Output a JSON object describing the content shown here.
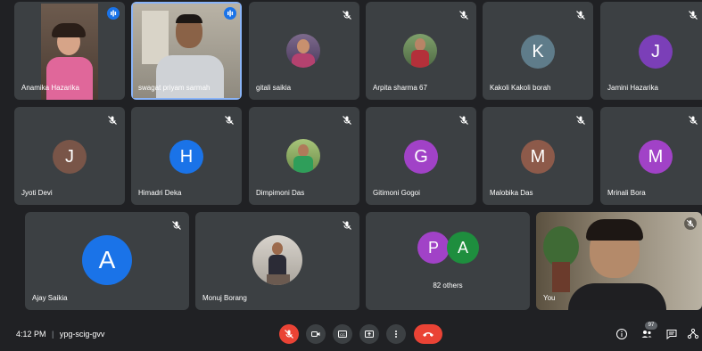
{
  "participants": [
    {
      "name": "Anamika Hazarika",
      "type": "photo",
      "speaking": true
    },
    {
      "name": "swagat priyam sarmah",
      "type": "photo",
      "speaking": true,
      "highlighted": true
    },
    {
      "name": "gitali saikia",
      "type": "photo",
      "muted": true
    },
    {
      "name": "Arpita sharma 67",
      "type": "photo",
      "muted": true
    },
    {
      "name": "Kakoli Kakoli borah",
      "initial": "K",
      "color": "#5f7c8a",
      "muted": true
    },
    {
      "name": "Jamini Hazarika",
      "initial": "J",
      "color": "#7b3fb8",
      "muted": true
    },
    {
      "name": "Jyoti Devi",
      "initial": "J",
      "color": "#795548",
      "muted": true
    },
    {
      "name": "Himadri Deka",
      "initial": "H",
      "color": "#1a73e8",
      "muted": true
    },
    {
      "name": "Dimpimoni Das",
      "type": "photo",
      "muted": true
    },
    {
      "name": "Gitimoni Gogoi",
      "initial": "G",
      "color": "#a142c7",
      "muted": true
    },
    {
      "name": "Malobika Das",
      "initial": "M",
      "color": "#8d5a4a",
      "muted": true
    },
    {
      "name": "Mrinali Bora",
      "initial": "M",
      "color": "#a142c7",
      "muted": true
    },
    {
      "name": "Ajay Saikia",
      "initial": "A",
      "color": "#1a73e8",
      "muted": true
    },
    {
      "name": "Monuj Borang",
      "type": "photo",
      "muted": true
    },
    {
      "name": "82 others",
      "others_initials": [
        "P",
        "A"
      ],
      "others_colors": [
        "#a142c7",
        "#1e8e3e"
      ]
    },
    {
      "name": "You",
      "type": "self-video",
      "muted": true
    }
  ],
  "bottom_bar": {
    "time": "4:12 PM",
    "separator": "|",
    "meeting_code": "ypg-scig-gvv",
    "people_count": "97"
  },
  "colors": {
    "background": "#202124",
    "tile": "#3c4043",
    "end_call": "#ea4335",
    "speaking": "#1a73e8"
  }
}
